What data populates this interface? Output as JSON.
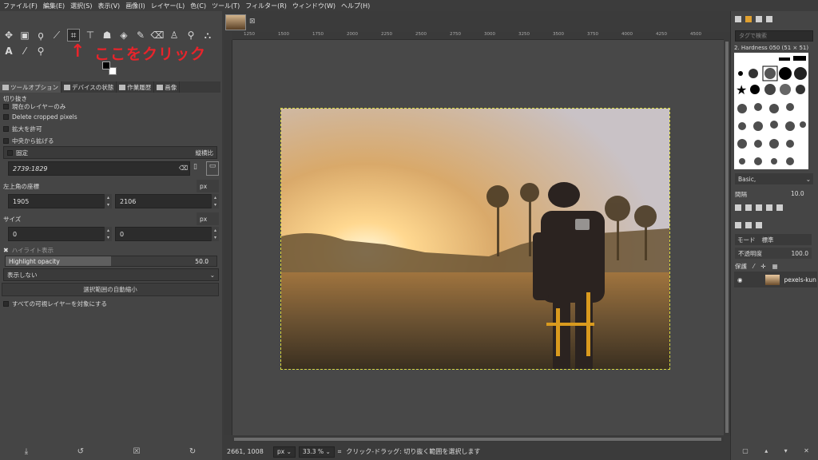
{
  "menubar": {
    "items": [
      "ファイル(F)",
      "編集(E)",
      "選択(S)",
      "表示(V)",
      "画像(I)",
      "レイヤー(L)",
      "色(C)",
      "ツール(T)",
      "フィルター(R)",
      "ウィンドウ(W)",
      "ヘルプ(H)"
    ]
  },
  "annotation": {
    "arrow": "↑",
    "text": "ここをクリック",
    "color": "#e8242b"
  },
  "dock_tabs": [
    "ツールオプション",
    "デバイスの状態",
    "作業履歴",
    "画像"
  ],
  "crop": {
    "title": "切り抜き",
    "opt_current_layer": "現在のレイヤーのみ",
    "opt_delete_pixels": "Delete cropped pixels",
    "opt_allow_grow": "拡大を許可",
    "opt_expand_center": "中央から拡げる",
    "fixed_label": "固定",
    "fixed_mode": "縦横比",
    "ratio_value": "2739:1829",
    "position_label": "左上角の座標",
    "position_unit": "px",
    "pos_x": "1905",
    "pos_y": "2106",
    "size_label": "サイズ",
    "size_unit": "px",
    "size_w": "0",
    "size_h": "0",
    "highlight_label": "ハイライト表示",
    "highlight_opacity_label": "Highlight opacity",
    "highlight_opacity_value": "50.0",
    "highlight_fraction": 0.5,
    "guides": "表示しない",
    "autoshrink": "選択範囲の自動縮小",
    "all_layers": "すべての可視レイヤーを対象にする"
  },
  "ruler_top": [
    "1250",
    "1500",
    "1750",
    "2000",
    "2250",
    "2500",
    "2750",
    "3000",
    "3250",
    "3500",
    "3750",
    "4000",
    "4250",
    "4500"
  ],
  "status": {
    "coords": "2661, 1008",
    "unit": "px",
    "zoom": "33.3 %",
    "message": "クリック-ドラッグ: 切り抜く範囲を選択します"
  },
  "brushes": {
    "search_placeholder": "タグで検索",
    "current": "2. Hardness 050 (51 × 51)",
    "preset": "Basic,",
    "spacing_label": "間隔",
    "spacing_value": "10.0"
  },
  "layers": {
    "mode_label": "モード",
    "mode_value": "標準",
    "opacity_label": "不透明度",
    "opacity_value": "100.0",
    "lock_label": "保護",
    "layer_name": "pexels-kun"
  }
}
